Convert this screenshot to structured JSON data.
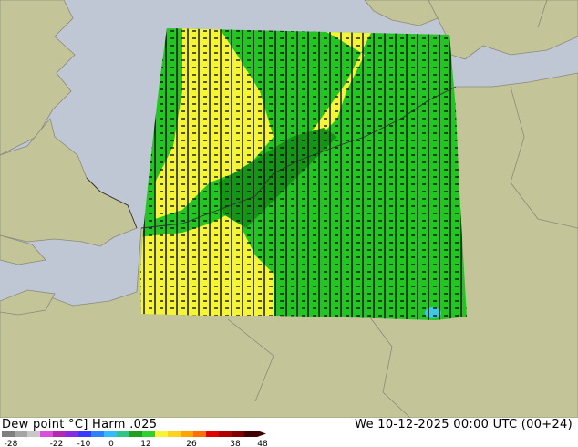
{
  "header": {
    "product": "Dew point °C]",
    "model": "Harm .025",
    "valid_time": "We 10-12-2025 00:00 UTC (00+24)"
  },
  "colorscale": {
    "ticks": [
      "-28",
      "-22",
      "-10",
      "0",
      "12",
      "26",
      "38",
      "48"
    ],
    "colors": [
      "#7f7f7f",
      "#a5a5a5",
      "#c8c8c8",
      "#d94fd9",
      "#b22ab2",
      "#8a2be2",
      "#3a3aff",
      "#2f7fff",
      "#33bbff",
      "#2ec48a",
      "#1fa01f",
      "#2fd12f",
      "#f5f536",
      "#ffd21f",
      "#ffa500",
      "#ff7000",
      "#e00000",
      "#b00000",
      "#800000",
      "#400000"
    ]
  },
  "map": {
    "sea_color": "#bfc7d5",
    "land_color": "#c3c599",
    "field_colors": {
      "green": "#22c522",
      "yellow": "#f5f536",
      "cyan": "#3ec8e6"
    }
  }
}
